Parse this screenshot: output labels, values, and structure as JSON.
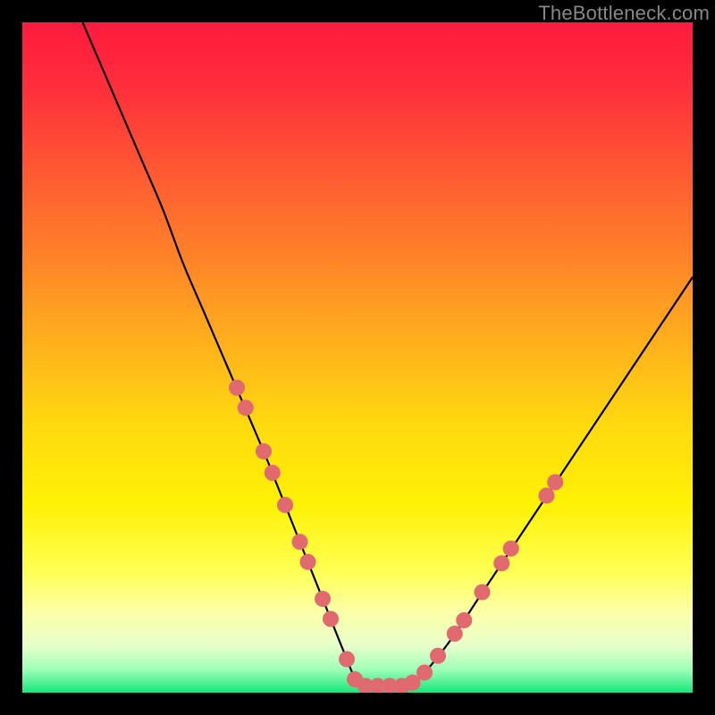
{
  "watermark": "TheBottleneck.com",
  "colors": {
    "bg_black": "#000000",
    "curve": "#000000",
    "dot_fill": "#e06a6f",
    "gradient_stops": [
      {
        "offset": 0.0,
        "color": "#ff1a3e"
      },
      {
        "offset": 0.1,
        "color": "#ff2f3b"
      },
      {
        "offset": 0.22,
        "color": "#ff5833"
      },
      {
        "offset": 0.35,
        "color": "#ff8228"
      },
      {
        "offset": 0.48,
        "color": "#ffb11c"
      },
      {
        "offset": 0.6,
        "color": "#ffd90f"
      },
      {
        "offset": 0.72,
        "color": "#fff205"
      },
      {
        "offset": 0.82,
        "color": "#ffff55"
      },
      {
        "offset": 0.88,
        "color": "#fdffa8"
      },
      {
        "offset": 0.93,
        "color": "#e7ffca"
      },
      {
        "offset": 0.965,
        "color": "#a0ffb8"
      },
      {
        "offset": 1.0,
        "color": "#18e67a"
      }
    ]
  },
  "chart_data": {
    "type": "line",
    "title": "",
    "xlabel": "",
    "ylabel": "",
    "xlim": [
      0,
      100
    ],
    "ylim": [
      0,
      100
    ],
    "grid": false,
    "legend": false,
    "series": [
      {
        "name": "bottleneck-curve",
        "x": [
          9,
          12,
          15,
          18,
          21,
          24,
          27,
          30,
          33,
          36,
          38,
          40,
          42,
          44,
          46,
          48,
          50,
          52,
          54,
          56,
          58,
          60,
          64,
          68,
          72,
          76,
          80,
          84,
          88,
          92,
          96,
          100
        ],
        "y": [
          100,
          93,
          86,
          79,
          72,
          64,
          57,
          50,
          43,
          36,
          31,
          26,
          21,
          16,
          11,
          6,
          1.5,
          1,
          1,
          1,
          1.5,
          3,
          8,
          14,
          20,
          26,
          32,
          38,
          44,
          50,
          56,
          62
        ]
      }
    ],
    "annotations": {
      "markers": [
        {
          "name": "left-cluster",
          "x": 32.0,
          "y": 45.5
        },
        {
          "name": "left-cluster",
          "x": 33.3,
          "y": 42.5
        },
        {
          "name": "left-cluster",
          "x": 36.0,
          "y": 36.0
        },
        {
          "name": "left-cluster",
          "x": 37.3,
          "y": 32.8
        },
        {
          "name": "left-cluster",
          "x": 39.2,
          "y": 28.0
        },
        {
          "name": "left-cluster",
          "x": 41.4,
          "y": 22.5
        },
        {
          "name": "left-cluster",
          "x": 42.6,
          "y": 19.5
        },
        {
          "name": "left-cluster",
          "x": 44.8,
          "y": 14.0
        },
        {
          "name": "left-cluster",
          "x": 46.0,
          "y": 11.0
        },
        {
          "name": "bottom-run",
          "x": 48.4,
          "y": 5.0
        },
        {
          "name": "bottom-run",
          "x": 49.6,
          "y": 2.0
        },
        {
          "name": "bottom-run",
          "x": 51.2,
          "y": 1.0
        },
        {
          "name": "bottom-run",
          "x": 53.0,
          "y": 1.0
        },
        {
          "name": "bottom-run",
          "x": 54.8,
          "y": 1.0
        },
        {
          "name": "bottom-run",
          "x": 56.6,
          "y": 1.0
        },
        {
          "name": "bottom-run",
          "x": 58.2,
          "y": 1.5
        },
        {
          "name": "right-cluster",
          "x": 60.0,
          "y": 3.0
        },
        {
          "name": "right-cluster",
          "x": 62.0,
          "y": 5.5
        },
        {
          "name": "right-cluster",
          "x": 64.5,
          "y": 8.8
        },
        {
          "name": "right-cluster",
          "x": 65.9,
          "y": 10.8
        },
        {
          "name": "right-cluster",
          "x": 68.6,
          "y": 15.0
        },
        {
          "name": "right-cluster",
          "x": 71.5,
          "y": 19.3
        },
        {
          "name": "right-cluster",
          "x": 72.9,
          "y": 21.5
        },
        {
          "name": "right-cluster",
          "x": 78.2,
          "y": 29.4
        },
        {
          "name": "right-cluster",
          "x": 79.5,
          "y": 31.4
        }
      ],
      "marker_radius_px": 9
    }
  }
}
